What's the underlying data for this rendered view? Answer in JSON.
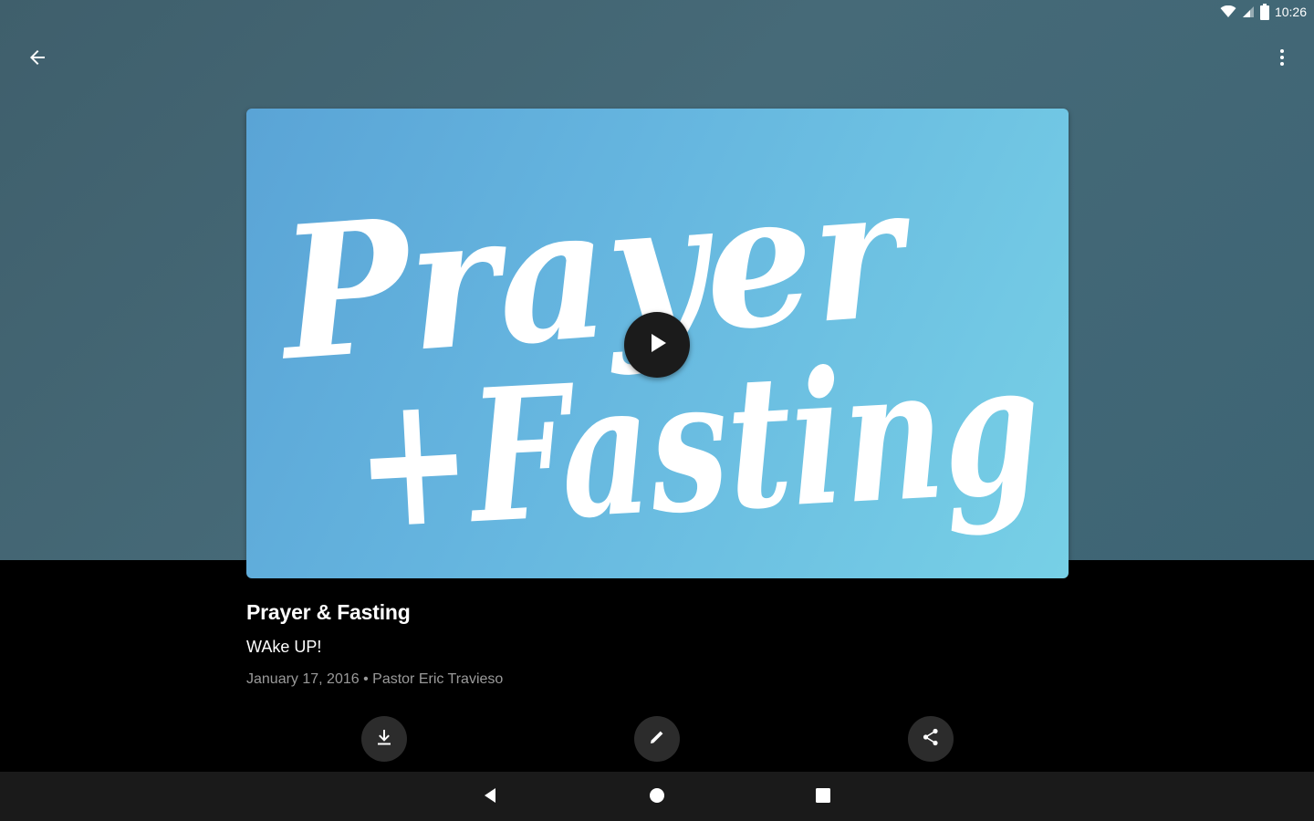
{
  "status_bar": {
    "time": "10:26",
    "icons": [
      "wifi-icon",
      "signal-icon",
      "battery-icon"
    ]
  },
  "app_bar": {
    "icons": [
      "back-arrow-icon",
      "overflow-menu-icon"
    ]
  },
  "artwork": {
    "line1": "Prayer",
    "line2": "+Fasting",
    "play_icon": "play-icon"
  },
  "sermon": {
    "title": "Prayer & Fasting",
    "series": "WAke UP!",
    "meta": "January 17, 2016 • Pastor Eric Travieso"
  },
  "actions": [
    {
      "icon": "download-icon"
    },
    {
      "icon": "edit-pencil-icon"
    },
    {
      "icon": "share-icon"
    }
  ],
  "nav_bar": {
    "icons": [
      "nav-back-icon",
      "nav-home-icon",
      "nav-recents-icon"
    ]
  },
  "colors": {
    "hero_background": "#466a78",
    "artwork_blue": "#65b5df",
    "text_primary": "#ffffff",
    "text_secondary": "#9a9a9a"
  }
}
